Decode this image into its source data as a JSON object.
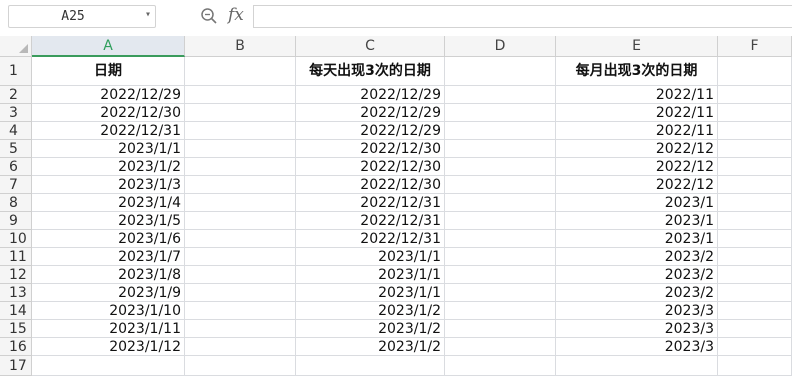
{
  "name_box": {
    "value": "A25"
  },
  "formula_bar": {
    "value": ""
  },
  "columns": [
    "A",
    "B",
    "C",
    "D",
    "E",
    "F"
  ],
  "selected_column": "A",
  "row_numbers": [
    "1",
    "2",
    "3",
    "4",
    "5",
    "6",
    "7",
    "8",
    "9",
    "10",
    "11",
    "12",
    "13",
    "14",
    "15",
    "16",
    "17"
  ],
  "headers": {
    "A": "日期",
    "C": "每天出现3次的日期",
    "E": "每月出现3次的日期"
  },
  "col_a": [
    "2022/12/29",
    "2022/12/30",
    "2022/12/31",
    "2023/1/1",
    "2023/1/2",
    "2023/1/3",
    "2023/1/4",
    "2023/1/5",
    "2023/1/6",
    "2023/1/7",
    "2023/1/8",
    "2023/1/9",
    "2023/1/10",
    "2023/1/11",
    "2023/1/12"
  ],
  "col_c": [
    "2022/12/29",
    "2022/12/29",
    "2022/12/29",
    "2022/12/30",
    "2022/12/30",
    "2022/12/30",
    "2022/12/31",
    "2022/12/31",
    "2022/12/31",
    "2023/1/1",
    "2023/1/1",
    "2023/1/1",
    "2023/1/2",
    "2023/1/2",
    "2023/1/2"
  ],
  "col_e": [
    "2022/11",
    "2022/11",
    "2022/11",
    "2022/12",
    "2022/12",
    "2022/12",
    "2023/1",
    "2023/1",
    "2023/1",
    "2023/2",
    "2023/2",
    "2023/2",
    "2023/3",
    "2023/3",
    "2023/3"
  ]
}
